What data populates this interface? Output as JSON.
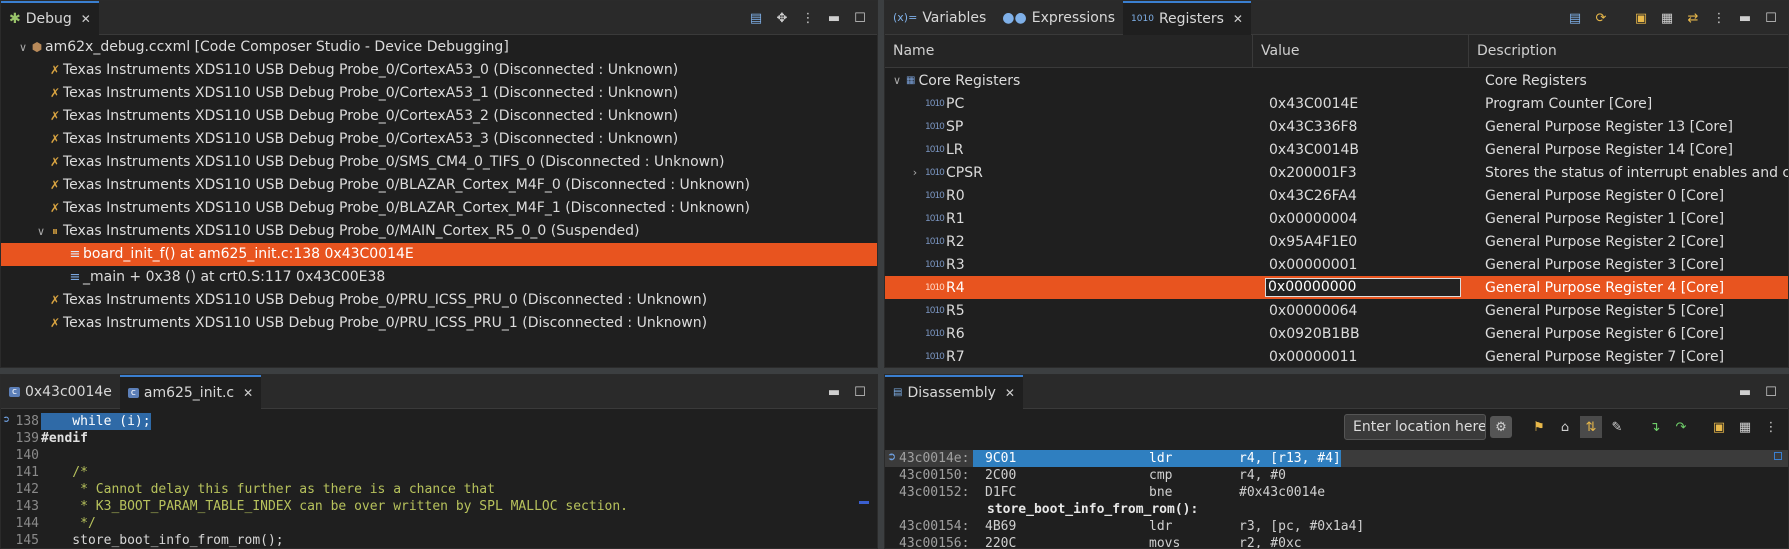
{
  "debug": {
    "tab_label": "Debug",
    "root": "am62x_debug.ccxml [Code Composer Studio - Device Debugging]",
    "items": [
      {
        "label": "Texas Instruments XDS110 USB Debug Probe_0/CortexA53_0 (Disconnected : Unknown)"
      },
      {
        "label": "Texas Instruments XDS110 USB Debug Probe_0/CortexA53_1 (Disconnected : Unknown)"
      },
      {
        "label": "Texas Instruments XDS110 USB Debug Probe_0/CortexA53_2 (Disconnected : Unknown)"
      },
      {
        "label": "Texas Instruments XDS110 USB Debug Probe_0/CortexA53_3 (Disconnected : Unknown)"
      },
      {
        "label": "Texas Instruments XDS110 USB Debug Probe_0/SMS_CM4_0_TIFS_0 (Disconnected : Unknown)"
      },
      {
        "label": "Texas Instruments XDS110 USB Debug Probe_0/BLAZAR_Cortex_M4F_0 (Disconnected : Unknown)"
      },
      {
        "label": "Texas Instruments XDS110 USB Debug Probe_0/BLAZAR_Cortex_M4F_1 (Disconnected : Unknown)"
      },
      {
        "label": "Texas Instruments XDS110 USB Debug Probe_0/MAIN_Cortex_R5_0_0 (Suspended)"
      }
    ],
    "frames": [
      {
        "label": "board_init_f() at am625_init.c:138 0x43C0014E"
      },
      {
        "label": "_main + 0x38 () at crt0.S:117 0x43C00E38"
      }
    ],
    "items_after": [
      {
        "label": "Texas Instruments XDS110 USB Debug Probe_0/PRU_ICSS_PRU_0 (Disconnected : Unknown)"
      },
      {
        "label": "Texas Instruments XDS110 USB Debug Probe_0/PRU_ICSS_PRU_1 (Disconnected : Unknown)"
      }
    ]
  },
  "registers": {
    "tabs": [
      "Variables",
      "Expressions",
      "Registers"
    ],
    "columns": [
      "Name",
      "Value",
      "Description"
    ],
    "group": {
      "name": "Core Registers",
      "desc": "Core Registers"
    },
    "rows": [
      {
        "name": "PC",
        "value": "0x43C0014E",
        "desc": "Program Counter [Core]"
      },
      {
        "name": "SP",
        "value": "0x43C336F8",
        "desc": "General Purpose Register 13 [Core]"
      },
      {
        "name": "LR",
        "value": "0x43C0014B",
        "desc": "General Purpose Register 14 [Core]"
      },
      {
        "name": "CPSR",
        "value": "0x200001F3",
        "desc": "Stores the status of interrupt enables and cr"
      },
      {
        "name": "R0",
        "value": "0x43C26FA4",
        "desc": "General Purpose Register 0 [Core]"
      },
      {
        "name": "R1",
        "value": "0x00000004",
        "desc": "General Purpose Register 1 [Core]"
      },
      {
        "name": "R2",
        "value": "0x95A4F1E0",
        "desc": "General Purpose Register 2 [Core]"
      },
      {
        "name": "R3",
        "value": "0x00000001",
        "desc": "General Purpose Register 3 [Core]"
      },
      {
        "name": "R4",
        "value": "0x00000000",
        "desc": "General Purpose Register 4 [Core]"
      },
      {
        "name": "R5",
        "value": "0x00000064",
        "desc": "General Purpose Register 5 [Core]"
      },
      {
        "name": "R6",
        "value": "0x0920B1BB",
        "desc": "General Purpose Register 6 [Core]"
      },
      {
        "name": "R7",
        "value": "0x00000011",
        "desc": "General Purpose Register 7 [Core]"
      }
    ]
  },
  "editor": {
    "tabs": [
      "0x43c0014e",
      "am625_init.c"
    ],
    "lines": [
      {
        "num": "138",
        "text": "    while (i);"
      },
      {
        "num": "139",
        "text": "#endif"
      },
      {
        "num": "140",
        "text": ""
      },
      {
        "num": "141",
        "text": "    /*"
      },
      {
        "num": "142",
        "text": "     * Cannot delay this further as there is a chance that"
      },
      {
        "num": "143",
        "text": "     * K3_BOOT_PARAM_TABLE_INDEX can be over written by SPL MALLOC section."
      },
      {
        "num": "144",
        "text": "     */"
      },
      {
        "num": "145",
        "text": "    store_boot_info_from_rom();"
      }
    ]
  },
  "disassembly": {
    "tab_label": "Disassembly",
    "location_placeholder": "Enter location here",
    "rows": [
      {
        "addr": "43c0014e:",
        "op": "9C01",
        "mn": "ldr",
        "args": "r4, [r13, #4]"
      },
      {
        "addr": "43c00150:",
        "op": "2C00",
        "mn": "cmp",
        "args": "r4, #0"
      },
      {
        "addr": "43c00152:",
        "op": "D1FC",
        "mn": "bne",
        "args": "#0x43c0014e"
      },
      {
        "label": "store_boot_info_from_rom():"
      },
      {
        "addr": "43c00154:",
        "op": "4B69",
        "mn": "ldr",
        "args": "r3, [pc, #0x1a4]"
      },
      {
        "addr": "43c00156:",
        "op": "220C",
        "mn": "movs",
        "args": "r2, #0xc"
      }
    ]
  }
}
